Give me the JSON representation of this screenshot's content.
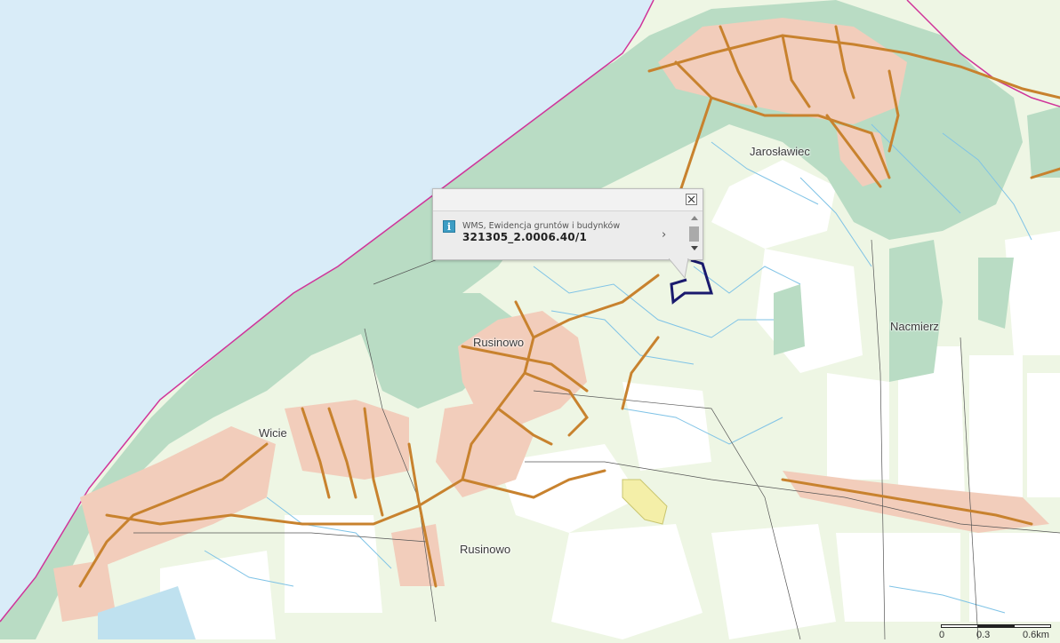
{
  "map": {
    "colors": {
      "sea": "#d9ecf8",
      "forest": "#b9dcc4",
      "meadow": "#eef6e4",
      "field": "#ffffff",
      "settlement": "#f2cdbb",
      "road": "#c8822e",
      "water_lines": "#7fc3e6",
      "boundary": "#d0359a",
      "parcel_outline": "#1a1a6e"
    },
    "places": [
      {
        "name": "Jarosławiec",
        "key": "jaroslawiec"
      },
      {
        "name": "Rusinowo",
        "key": "rusinowo-north"
      },
      {
        "name": "Nacmierz",
        "key": "nacmierz"
      },
      {
        "name": "Wicie",
        "key": "wicie"
      },
      {
        "name": "Rusinowo",
        "key": "rusinowo-south"
      }
    ]
  },
  "popup": {
    "layer_name": "WMS, Ewidencja gruntów i budynków",
    "parcel_id": "321305_2.0006.40/1",
    "info_icon": "info-icon",
    "close_icon": "close-icon",
    "next_icon": "chevron-right-icon"
  },
  "scale": {
    "ticks": [
      "0",
      "0.3",
      "0.6km"
    ]
  }
}
